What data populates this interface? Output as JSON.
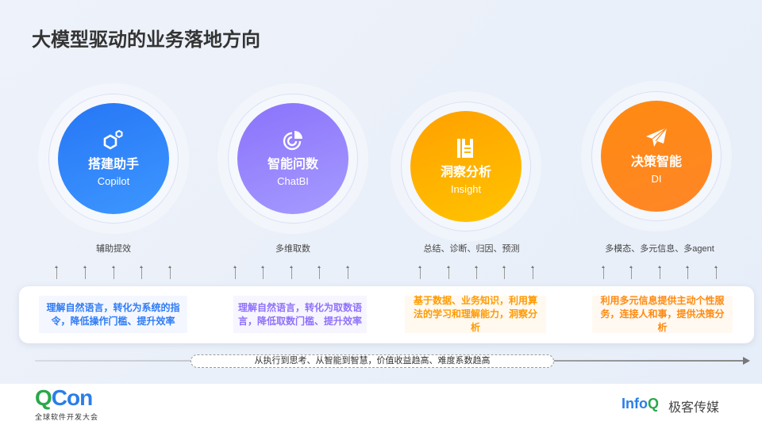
{
  "title": "大模型驱动的业务落地方向",
  "directions": [
    {
      "cn": "搭建助手",
      "en": "Copilot",
      "icon": "hexagon-icon",
      "label": "辅助提效",
      "desc": "理解自然语言，转化为系统的指令，降低操作门槛、提升效率",
      "color": "#3a86f8"
    },
    {
      "cn": "智能问数",
      "en": "ChatBI",
      "icon": "pie-chart-icon",
      "label": "多维取数",
      "desc": "理解自然语言，转化为取数语言，降低取数门槛、提升效率",
      "color": "#8f7bfc"
    },
    {
      "cn": "洞察分析",
      "en": "Insight",
      "icon": "notebook-icon",
      "label": "总结、诊断、归因、预测",
      "desc": "基于数据、业务知识，利用算法的学习和理解能力，洞察分析",
      "color": "#ffa400"
    },
    {
      "cn": "决策智能",
      "en": "DI",
      "icon": "paper-plane-icon",
      "label": "多模态、多元信息、多agent",
      "desc": "利用多元信息提供主动个性服务，连接人和事，提供决策分析",
      "color": "#ff8a1e"
    }
  ],
  "progress_caption": "从执行到思考、从智能到智慧，价值收益趋高、难度系数趋高",
  "footer": {
    "qcon_q": "Q",
    "qcon_rest": "Con",
    "qcon_sub": "全球软件开发大会",
    "infoq_info": "Info",
    "infoq_q": "Q",
    "infoq_cn": "极客传媒"
  }
}
